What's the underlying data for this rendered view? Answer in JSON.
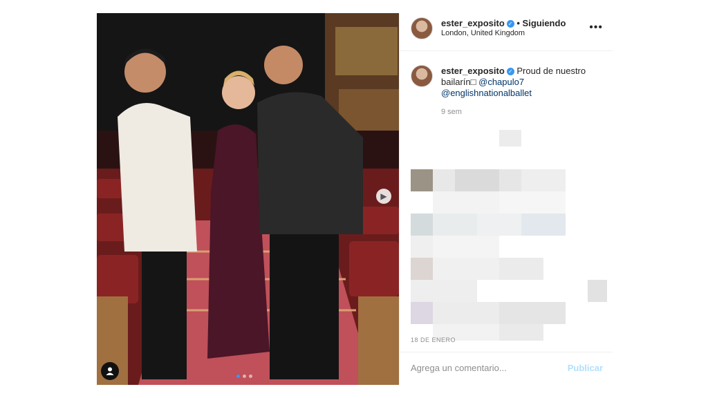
{
  "post": {
    "username": "ester_exposito",
    "verified": true,
    "follow_status": "• Siguiendo",
    "location": "London, United Kingdom",
    "more_icon": "more-horizontal-icon",
    "caption_username": "ester_exposito",
    "caption_text": " Proud de nuestro bailarín",
    "caption_emoji_placeholder": "□",
    "mention_1": "@chapulo7",
    "mention_2": "@englishnationalballet",
    "time_ago": "9 sem",
    "date_label": "18 DE ENERO",
    "carousel": {
      "count": 3,
      "active": 0
    }
  },
  "comment": {
    "placeholder": "Agrega un comentario...",
    "publish_label": "Publicar"
  },
  "colors": {
    "link": "#003569",
    "verified": "#3897f0",
    "publish_disabled": "#b2dffc"
  }
}
